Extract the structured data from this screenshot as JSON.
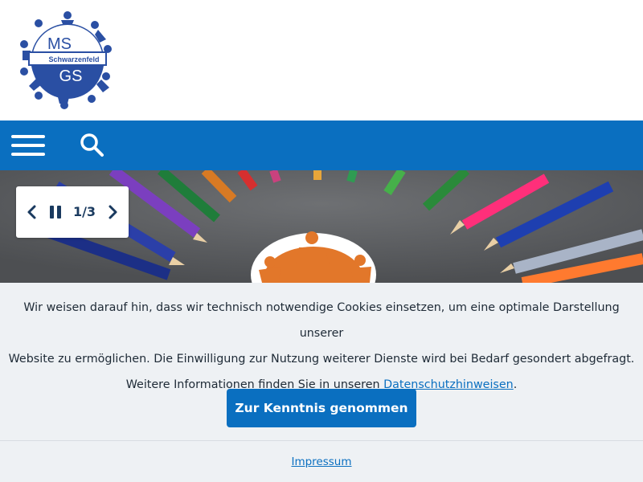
{
  "logo": {
    "top_text": "MS",
    "band_text": "Schwarzenfeld",
    "bottom_text": "GS",
    "color": "#2a4fa3"
  },
  "nav": {
    "menu_icon": "hamburger-icon",
    "search_icon": "search-icon",
    "color": "#0a6fc0"
  },
  "slider": {
    "counter": "1/3",
    "prev_icon": "chevron-left-icon",
    "pause_icon": "pause-icon",
    "next_icon": "chevron-right-icon"
  },
  "cookie": {
    "line1": "Wir weisen darauf hin, dass wir technisch notwendige Cookies einsetzen, um eine optimale Darstellung unserer",
    "line2": "Website zu ermöglichen. Die Einwilligung zur Nutzung weiterer Dienste wird bei Bedarf gesondert abgefragt.",
    "line3_prefix": "Weitere Informationen finden Sie in unseren ",
    "link": "Datenschutzhinweisen",
    "line3_suffix": ".",
    "button": "Zur Kenntnis genommen"
  },
  "footer": {
    "link": "Impressum"
  }
}
